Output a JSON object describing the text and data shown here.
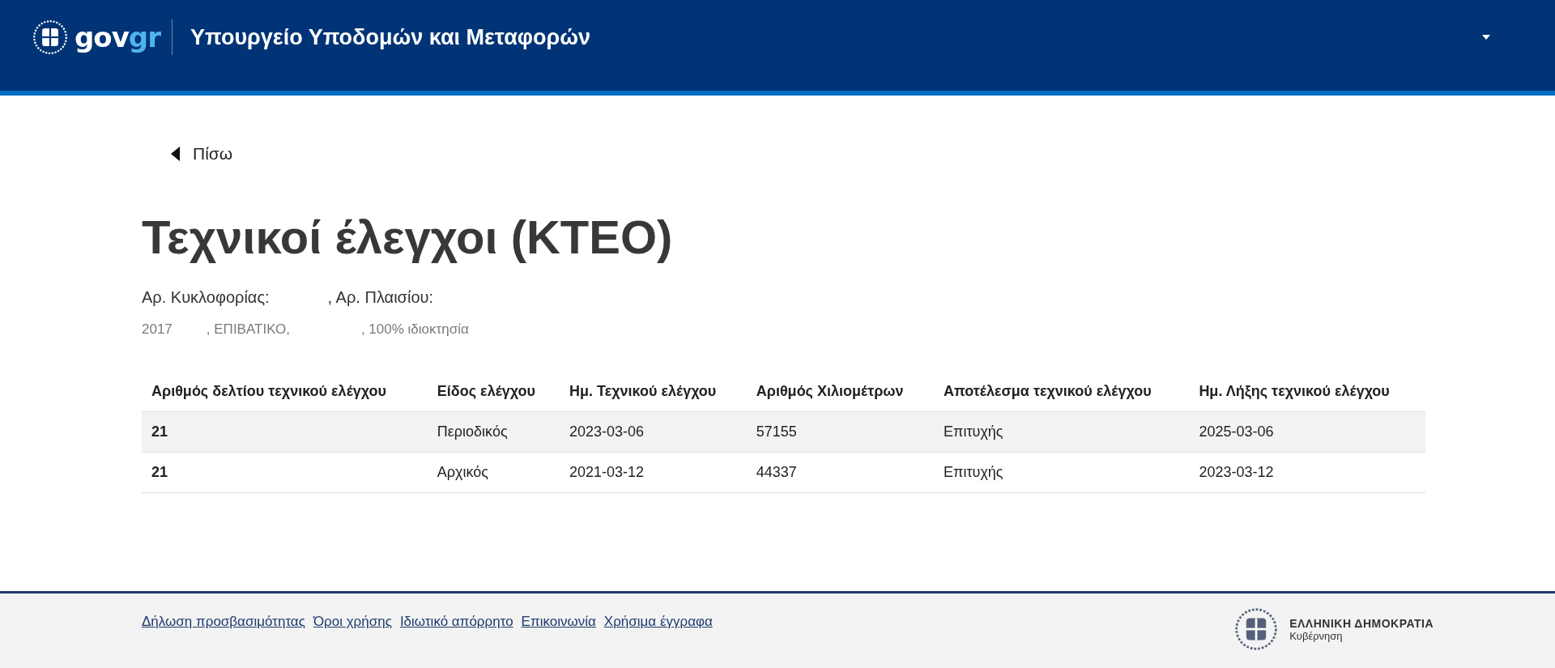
{
  "header": {
    "logo_text": "gov",
    "logo_accent": "gr",
    "title": "Υπουργείο Υποδομών και Μεταφορών"
  },
  "back_link": "Πίσω",
  "heading": "Τεχνικοί έλεγχοι (ΚΤΕΟ)",
  "vehicle": {
    "plate_label": "Αρ. Κυκλοφορίας:",
    "chassis_label": ", Αρ. Πλαισίου:",
    "details": [
      "2017",
      ", ΕΠΙΒΑΤΙΚΟ,",
      ", 100% ιδιοκτησία"
    ]
  },
  "table": {
    "columns": [
      "Αριθμός δελτίου τεχνικού ελέγχου",
      "Είδος ελέγχου",
      "Ημ. Τεχνικού ελέγχου",
      "Αριθμός Χιλιομέτρων",
      "Αποτέλεσμα τεχνικού ελέγχου",
      "Ημ. Λήξης τεχνικού ελέγχου"
    ],
    "rows": [
      {
        "selected": true,
        "cells": [
          "21",
          "Περιοδικός",
          "2023-03-06",
          "57155",
          "Επιτυχής",
          "2025-03-06"
        ]
      },
      {
        "selected": false,
        "cells": [
          "21",
          "Αρχικός",
          "2021-03-12",
          "44337",
          "Επιτυχής",
          "2023-03-12"
        ]
      }
    ]
  },
  "footer": {
    "links": [
      "Δήλωση προσβασιμότητας",
      "Όροι χρήσης",
      "Ιδιωτικό απόρρητο",
      "Επικοινωνία",
      "Χρήσιμα έγγραφα"
    ],
    "org_name": "ΕΛΛΗΝΙΚΗ ΔΗΜΟΚΡΑΤΙΑ",
    "org_sub": "Κυβέρνηση"
  }
}
